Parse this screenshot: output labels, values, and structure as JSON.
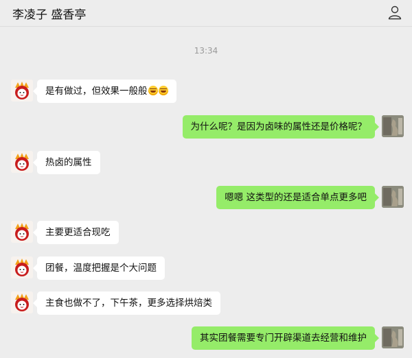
{
  "header": {
    "title": "李凌子 盛香亭",
    "contact_icon": "person-icon"
  },
  "timestamp": "13:34",
  "messages": [
    {
      "side": "left",
      "text": "是有做过，但效果一般般",
      "emoji_count": 2,
      "emoji": "laughing-tears-emoji"
    },
    {
      "side": "right",
      "text": "为什么呢？是因为卤味的属性还是价格呢？"
    },
    {
      "side": "left",
      "text": "热卤的属性"
    },
    {
      "side": "right",
      "text": "嗯嗯 这类型的还是适合单点更多吧"
    },
    {
      "side": "left",
      "text": "主要更适合现吃"
    },
    {
      "side": "left",
      "text": "团餐，温度把握是个大问题"
    },
    {
      "side": "left",
      "text": "主食也做不了，下午茶，更多选择烘焙类"
    },
    {
      "side": "right",
      "text": "其实团餐需要专门开辟渠道去经营和维护"
    }
  ],
  "colors": {
    "background": "#ededed",
    "incoming_bubble": "#ffffff",
    "outgoing_bubble": "#95ec69"
  }
}
